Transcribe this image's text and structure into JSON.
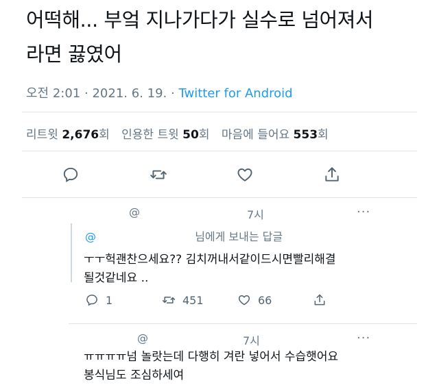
{
  "tweet": {
    "text_line1": "어떡해... 부엌 지나가다가 실수로 넘어져서",
    "text_line2": "라면 끓였어",
    "time": "오전 2:01",
    "dot1": "·",
    "date": "2021. 6. 19.",
    "dot2": "·",
    "source": "Twitter for Android"
  },
  "stats": {
    "retweets_label": "리트윗",
    "retweets_count": "2,676",
    "retweets_unit": "회",
    "quotes_label": "인용한 트윗",
    "quotes_count": "50",
    "quotes_unit": "회",
    "likes_label": "마음에 들어요",
    "likes_count": "553",
    "likes_unit": "회"
  },
  "actions": [
    "reply-icon",
    "retweet-icon",
    "like-icon",
    "share-icon"
  ],
  "replies": [
    {
      "handle": "@",
      "time": "7시",
      "more": "···",
      "replying_at": "@",
      "replying_text": "님에게 보내는 답글",
      "body_line1": "ㅜㅜ헉괜찬으세요?? 김치꺼내서같이드시면빨리해결",
      "body_line2": "될것같네요 ..",
      "reply_count": "1",
      "retweet_count": "451",
      "like_count": "66"
    },
    {
      "handle": "@",
      "time": "7시",
      "more": "···",
      "body_line1": "ㅠㅠㅠㅠ넘 놀랏는데 다행히 겨란 넣어서 수습햇어요",
      "body_line2": "봉식님도 조심하세여"
    }
  ],
  "colors": {
    "accent": "#1d9bf0",
    "muted": "#657786",
    "text": "#0f1419"
  }
}
